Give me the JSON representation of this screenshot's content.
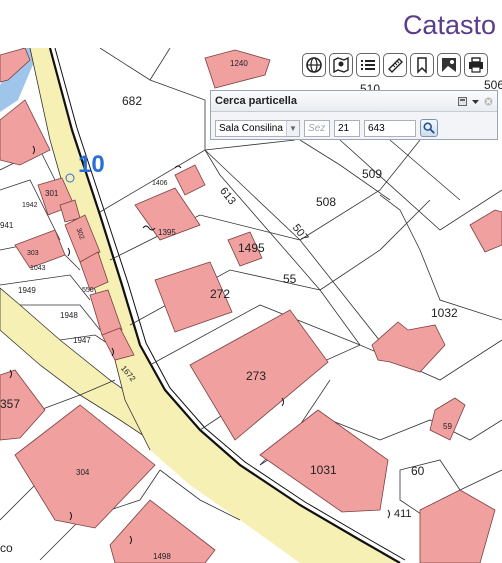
{
  "header": {
    "title": "Catasto"
  },
  "toolbar": {
    "buttons": [
      {
        "name": "globe-icon"
      },
      {
        "name": "map-layers-icon"
      },
      {
        "name": "list-icon"
      },
      {
        "name": "ruler-icon"
      },
      {
        "name": "bookmark-icon"
      },
      {
        "name": "photo-icon"
      },
      {
        "name": "print-icon"
      }
    ]
  },
  "search_panel": {
    "title": "Cerca particella",
    "comune": "Sala Consilina",
    "sezione_placeholder": "Sez",
    "foglio": "21",
    "particella": "643"
  },
  "map": {
    "sheet_number": "10",
    "colors": {
      "building": "#f1a0a0",
      "road": "#f6f0b4",
      "water": "#9fc6ea",
      "background": "#ffffff"
    },
    "parcel_labels": [
      "682",
      "1240",
      "506",
      "510",
      "509",
      "508",
      "507",
      "613",
      "1406",
      "1395",
      "1495",
      "55",
      "272",
      "1032",
      "273",
      "59",
      "1031",
      "60",
      "411",
      "301",
      "1942",
      "941",
      "303",
      "1043",
      "302",
      "550",
      "1949",
      "1948",
      "1947",
      "1672",
      "357",
      "304",
      "1498",
      "co"
    ]
  }
}
